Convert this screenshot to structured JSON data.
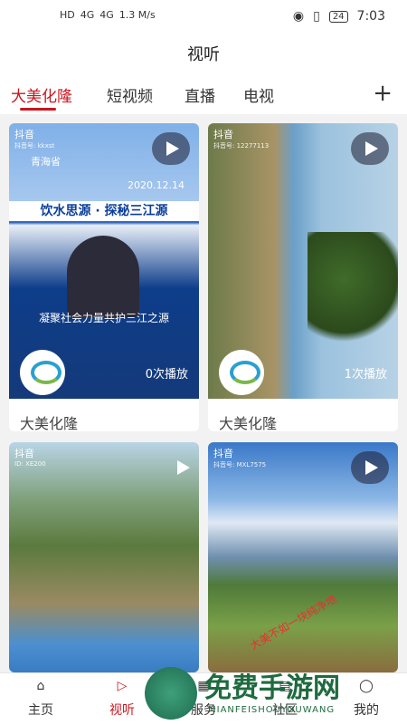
{
  "status": {
    "net1": "HD",
    "net2": "HD",
    "sig1": "4G",
    "sig2": "4G",
    "speed": "1.3 M/s",
    "battery": "24",
    "time": "7:03"
  },
  "title": "视听",
  "tabs": [
    "大美化隆",
    "短视频",
    "直播",
    "电视"
  ],
  "cards": [
    {
      "app": "抖音",
      "id": "抖音号: kkxst",
      "overlay_loc": "青海省",
      "overlay_date": "2020.12.14",
      "overlay_title": "饮水思源 · 探秘三江源",
      "overlay_caption": "凝聚社会力量共护三江之源",
      "plays": "0次播放",
      "title": "大美化隆"
    },
    {
      "app": "抖音",
      "id": "抖音号: 12277113",
      "plays": "1次播放",
      "title": "大美化隆"
    },
    {
      "app": "抖音",
      "id": "ID: XE200"
    },
    {
      "app": "抖音",
      "id": "抖音号: MXL7575",
      "overlay_text": "大美不如一块纯净地"
    }
  ],
  "nav": [
    "主页",
    "视听",
    "服务",
    "社区",
    "我的"
  ],
  "watermark": {
    "main": "免费手游网",
    "sub": "MIANFEISHOUYOUWANG"
  }
}
